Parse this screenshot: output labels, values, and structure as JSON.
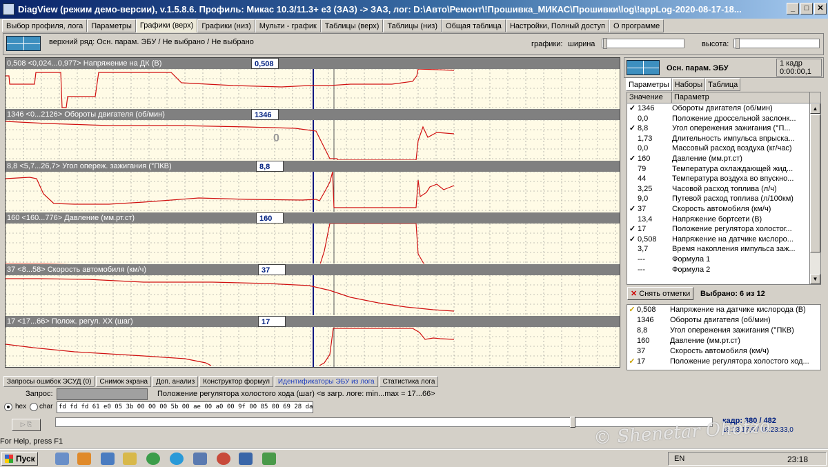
{
  "window": {
    "title": "DiagView (режим демо-версии), v.1.5.8.6. Профиль: Микас 10.3/11.3+ e3 (ЗАЗ) -> ЗАЗ,   лог: D:\\Авто\\Ремонт\\!Прошивка_МИКАС\\Прошивки\\log\\!appLog-2020-08-17-18...",
    "minimize": "_",
    "maximize": "□",
    "close": "✕"
  },
  "tabs": [
    "Выбор профиля, лога",
    "Параметры",
    "Графики (верх)",
    "Графики (низ)",
    "Мульти - график",
    "Таблицы (верх)",
    "Таблицы (низ)",
    "Общая таблица",
    "Настройки, Полный доступ",
    "О программе"
  ],
  "toolbar": {
    "info": "верхний ряд: Осн. парам. ЭБУ / Не выбрано / Не выбрано",
    "charts_label": "графики:",
    "width_label": "ширина",
    "height_label": "высота:"
  },
  "charts": [
    {
      "range": "0,508   <0,024...0,977>  Напряжение на ДК (В)",
      "value": "0,508"
    },
    {
      "range": "1346   <0...2126>  Обороты двигателя (об/мин)",
      "value": "1346"
    },
    {
      "range": "8,8   <5,7...26,7>  Угол опереж. зажигания (°ПКВ)",
      "value": "8,8"
    },
    {
      "range": "160   <160...776>  Давление (мм.рт.ст)",
      "value": "160"
    },
    {
      "range": "37   <8...58>  Скорость автомобиля (км/ч)",
      "value": "37"
    },
    {
      "range": "17   <17...66>  Полож. регул. ХХ (шаг)",
      "value": "17"
    }
  ],
  "chart_zero_label": "0",
  "right": {
    "title": "Осн. парам. ЭБУ",
    "frames": "1 кадр",
    "time": "0:00:00,1",
    "tabs": [
      "Параметры",
      "Наборы",
      "Таблица"
    ],
    "col_value": "Значение",
    "col_param": "Параметр",
    "params": [
      {
        "c": "✓",
        "v": "1346",
        "n": "Обороты двигателя (об/мин)"
      },
      {
        "c": "",
        "v": "0,0",
        "n": "Положение дроссельной заслонк..."
      },
      {
        "c": "✓",
        "v": "8,8",
        "n": "Угол опережения зажигания (°П..."
      },
      {
        "c": "",
        "v": "1,73",
        "n": "Длительность импульса впрыска..."
      },
      {
        "c": "",
        "v": "0,0",
        "n": "Массовый расход воздуха (кг/час)"
      },
      {
        "c": "✓",
        "v": "160",
        "n": "Давление (мм.рт.ст)"
      },
      {
        "c": "",
        "v": "79",
        "n": "Температура охлаждающей жид..."
      },
      {
        "c": "",
        "v": "44",
        "n": "Температура воздуха во впускно..."
      },
      {
        "c": "",
        "v": "3,25",
        "n": "Часовой расход топлива (л/ч)"
      },
      {
        "c": "",
        "v": "9,0",
        "n": "Путевой расход топлива (л/100км)"
      },
      {
        "c": "✓",
        "v": "37",
        "n": "Скорость автомобиля (км/ч)"
      },
      {
        "c": "",
        "v": "13,4",
        "n": "Напряжение бортсети (В)"
      },
      {
        "c": "✓",
        "v": "17",
        "n": "Положение регулятора холостог..."
      },
      {
        "c": "✓",
        "v": "0,508",
        "n": "Напряжение на датчике кислоро..."
      },
      {
        "c": "",
        "v": "3,7",
        "n": "Время накопления импульса заж..."
      },
      {
        "c": "",
        "v": "---",
        "n": "Формула 1"
      },
      {
        "c": "",
        "v": "---",
        "n": "Формула 2"
      }
    ],
    "uncheck_btn": "Снять отметки",
    "selected": "Выбрано: 6 из 12",
    "selected_list": [
      {
        "c": "✓",
        "v": "0,508",
        "n": "Напряжение на датчике кислорода (В)"
      },
      {
        "c": "",
        "v": "1346",
        "n": "Обороты двигателя (об/мин)"
      },
      {
        "c": "",
        "v": "8,8",
        "n": "Угол опережения зажигания (°ПКВ)"
      },
      {
        "c": "",
        "v": "160",
        "n": "Давление (мм.рт.ст)"
      },
      {
        "c": "",
        "v": "37",
        "n": "Скорость автомобиля (км/ч)"
      },
      {
        "c": "✓",
        "v": "17",
        "n": "Положение регулятора холостого ход..."
      }
    ]
  },
  "bottom": {
    "tabs": [
      "Запросы ошибок ЭСУД (0)",
      "Снимок экрана",
      "Доп. анализ",
      "Конструктор формул",
      "Идентификаторы ЭБУ из лога",
      "Статистика лога"
    ],
    "query_label": "Запрос:",
    "desc": "Положение регулятора холостого хода (шаг) <в загр. логе: min...max = 17...66>",
    "hex_label": "hex",
    "char_label": "char",
    "hex": "fd fd fd 61 e0 05 3b 00 00 00 5b 00 ae 00 a0 00 9f 00 85 00 69 28 da 77 54 00 00 ...",
    "frame": "кадр: 380 / 482",
    "time": "18:23:17,6 / 18:23:33,0",
    "status": "For Help, press F1",
    "play": "▷ ⎘"
  },
  "taskbar": {
    "start": "Пуск",
    "lang": "EN",
    "time": "23:18"
  },
  "watermark": "© Shenetar Ohotzo"
}
